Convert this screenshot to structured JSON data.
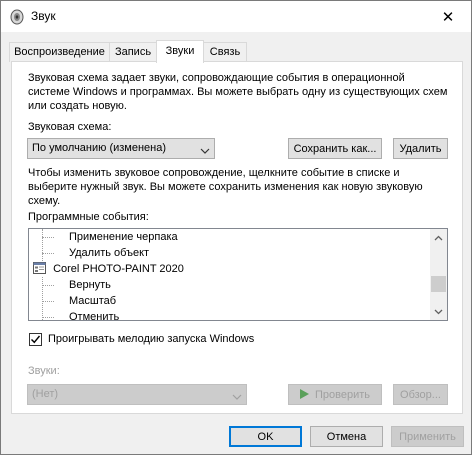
{
  "window": {
    "title": "Звук",
    "close_glyph": "✕"
  },
  "tabs": [
    {
      "label": "Воспроизведение"
    },
    {
      "label": "Запись"
    },
    {
      "label": "Звуки"
    },
    {
      "label": "Связь"
    }
  ],
  "scheme": {
    "description": "Звуковая схема задает звуки, сопровождающие события в операционной системе Windows и программах. Вы можете выбрать одну из существующих схем или создать новую.",
    "label": "Звуковая схема:",
    "selected": "По умолчанию (изменена)",
    "save_label": "Сохранить как...",
    "delete_label": "Удалить"
  },
  "events": {
    "description": "Чтобы изменить звуковое сопровождение, щелкните событие в списке и выберите нужный звук. Вы можете сохранить изменения как новую звуковую схему.",
    "label": "Программные события:",
    "items": [
      {
        "label": "Применение черпака",
        "type": "child"
      },
      {
        "label": "Удалить объект",
        "type": "child"
      },
      {
        "label": "Corel PHOTO-PAINT 2020",
        "type": "group"
      },
      {
        "label": "Вернуть",
        "type": "child"
      },
      {
        "label": "Масштаб",
        "type": "child"
      },
      {
        "label": "Отменить",
        "type": "child"
      }
    ]
  },
  "startup": {
    "label": "Проигрывать мелодию запуска Windows",
    "checked": true
  },
  "sounds": {
    "label": "Звуки:",
    "selected": "(Нет)",
    "test_label": "Проверить",
    "browse_label": "Обзор..."
  },
  "footer": {
    "ok_label": "OK",
    "cancel_label": "Отмена",
    "apply_label": "Применить"
  },
  "colors": {
    "focus_border": "#0078d7",
    "disabled_text": "#a0a0a0",
    "play_green": "#5aa05a"
  }
}
